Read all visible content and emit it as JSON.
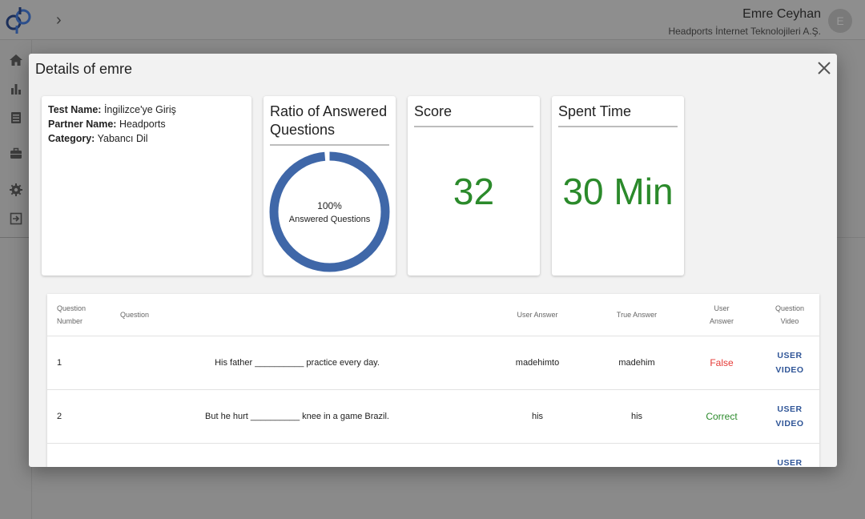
{
  "header": {
    "user_name": "Emre Ceyhan",
    "company": "Headports İnternet Teknolojileri A.Ş.",
    "avatar_initial": "E"
  },
  "modal": {
    "title": "Details of emre",
    "info": {
      "test_name_label": "Test Name:",
      "test_name": "İngilizce'ye Giriş",
      "partner_name_label": "Partner Name:",
      "partner_name": "Headports",
      "category_label": "Category:",
      "category": "Yabancı Dil"
    },
    "ratio": {
      "title": "Ratio of Answered Questions",
      "percent_label": "100%",
      "caption": "Answered Questions",
      "answered_fraction": 1.0,
      "color": "#3f67a8"
    },
    "score": {
      "title": "Score",
      "value": "32"
    },
    "spent_time": {
      "title": "Spent Time",
      "value": "30 Min"
    },
    "table": {
      "headers": {
        "number": "Question Number",
        "question": "Question",
        "user_answer": "User Answer",
        "true_answer": "True Answer",
        "result": "User Answer",
        "video": "Question Video"
      },
      "rows": [
        {
          "number": "1",
          "question": "His father __________ practice every day.",
          "user_answer": "madehimto",
          "true_answer": "madehim",
          "result": "False",
          "video_line1": "USER",
          "video_line2": "VIDEO"
        },
        {
          "number": "2",
          "question": "But he hurt __________ knee in a game Brazil.",
          "user_answer": "his",
          "true_answer": "his",
          "result": "Correct",
          "video_line1": "USER",
          "video_line2": "VIDEO"
        },
        {
          "number": "",
          "question": "",
          "user_answer": "",
          "true_answer": "",
          "result": "",
          "video_line1": "USER",
          "video_line2": ""
        }
      ]
    }
  },
  "colors": {
    "accent": "#3f67a8",
    "correct": "#2b8a2b",
    "false": "#e53935",
    "link": "#2f5597"
  },
  "icons": [
    "home-icon",
    "bar-chart-icon",
    "list-icon",
    "briefcase-icon",
    "gear-icon",
    "logout-icon",
    "chevron-right-icon",
    "close-icon"
  ]
}
